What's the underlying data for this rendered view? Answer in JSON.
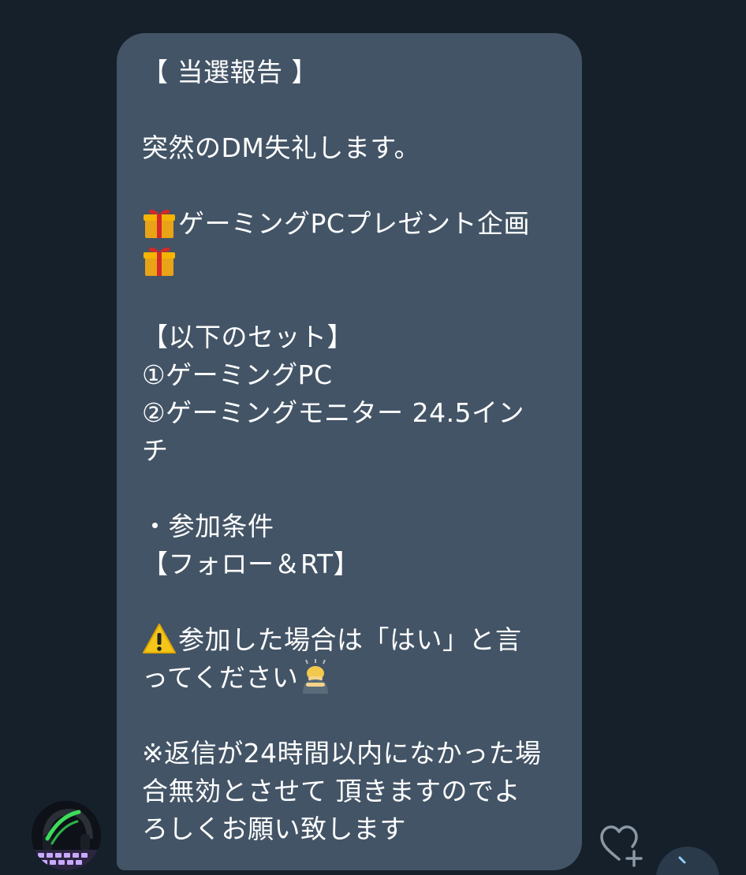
{
  "message": {
    "lines": [
      "【 当選報告 】",
      "",
      "突然のDM失礼します。",
      "",
      "ゲーミングPCプレゼント企画",
      "",
      "",
      "【以下のセット】",
      "①ゲーミングPC",
      "②ゲーミングモニター 24.5イン",
      "チ",
      "",
      "・参加条件",
      "【フォロー＆RT】",
      "",
      "参加した場合は「はい」と言",
      "ってください",
      "",
      "※返信が24時間以内になかった場",
      "合無効とさせて 頂きますのでよ",
      "ろしくお願い致します"
    ]
  },
  "icons": {
    "gift": "gift-emoji",
    "warning": "warning-emoji",
    "bow": "person-bowing-emoji",
    "reaction": "heart-add-icon",
    "avatar": "user-avatar"
  },
  "colors": {
    "background": "#15202b",
    "bubble": "#435466",
    "text": "#ffffff"
  }
}
